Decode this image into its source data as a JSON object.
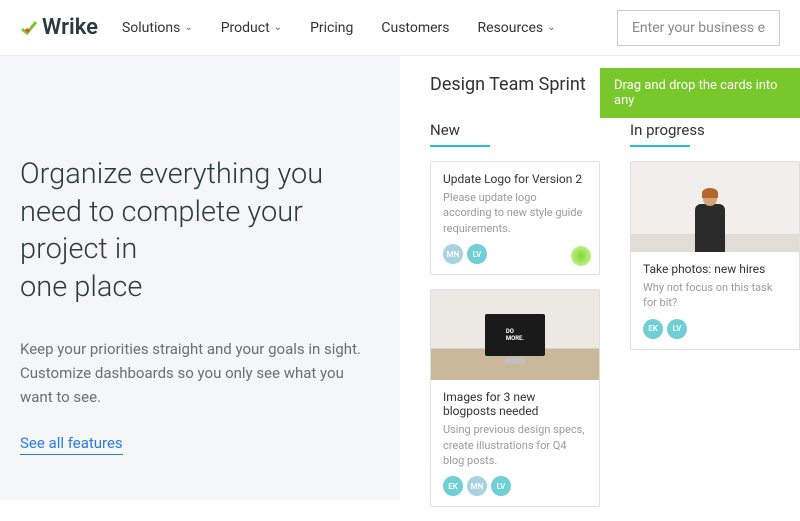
{
  "header": {
    "logo_text": "Wrike",
    "nav": [
      {
        "label": "Solutions",
        "dropdown": true
      },
      {
        "label": "Product",
        "dropdown": true
      },
      {
        "label": "Pricing",
        "dropdown": false
      },
      {
        "label": "Customers",
        "dropdown": false
      },
      {
        "label": "Resources",
        "dropdown": true
      }
    ],
    "search_placeholder": "Enter your business e"
  },
  "hero": {
    "headline": "Organize everything you need to complete your project in\none place",
    "sub": "Keep your priorities straight and your goals in sight. Customize dashboards so you only see what you want to see.",
    "link": "See all features"
  },
  "board": {
    "title": "Design Team Sprint",
    "banner": "Drag and drop the cards into any",
    "columns": [
      {
        "title": "New",
        "cards": [
          {
            "title": "Update Logo for Version 2",
            "desc": "Please update logo according to new style guide requirements.",
            "avatars": [
              "MN",
              "LV"
            ],
            "pulse": true,
            "image": null
          },
          {
            "title": "Images for 3 new blogposts needed",
            "desc": "Using previous design specs, create illustrations for Q4 blog posts.",
            "avatars": [
              "EK",
              "MN",
              "LV"
            ],
            "pulse": false,
            "image": "monitor"
          }
        ]
      },
      {
        "title": "In progress",
        "cards": [
          {
            "title": "Take photos: new hires",
            "desc": "Why not focus on this task for bit?",
            "avatars": [
              "EK",
              "LV"
            ],
            "pulse": false,
            "image": "photo"
          }
        ]
      }
    ]
  },
  "colors": {
    "accent": "#2bb8e6",
    "green": "#78c72b",
    "link": "#2b7bdf"
  }
}
